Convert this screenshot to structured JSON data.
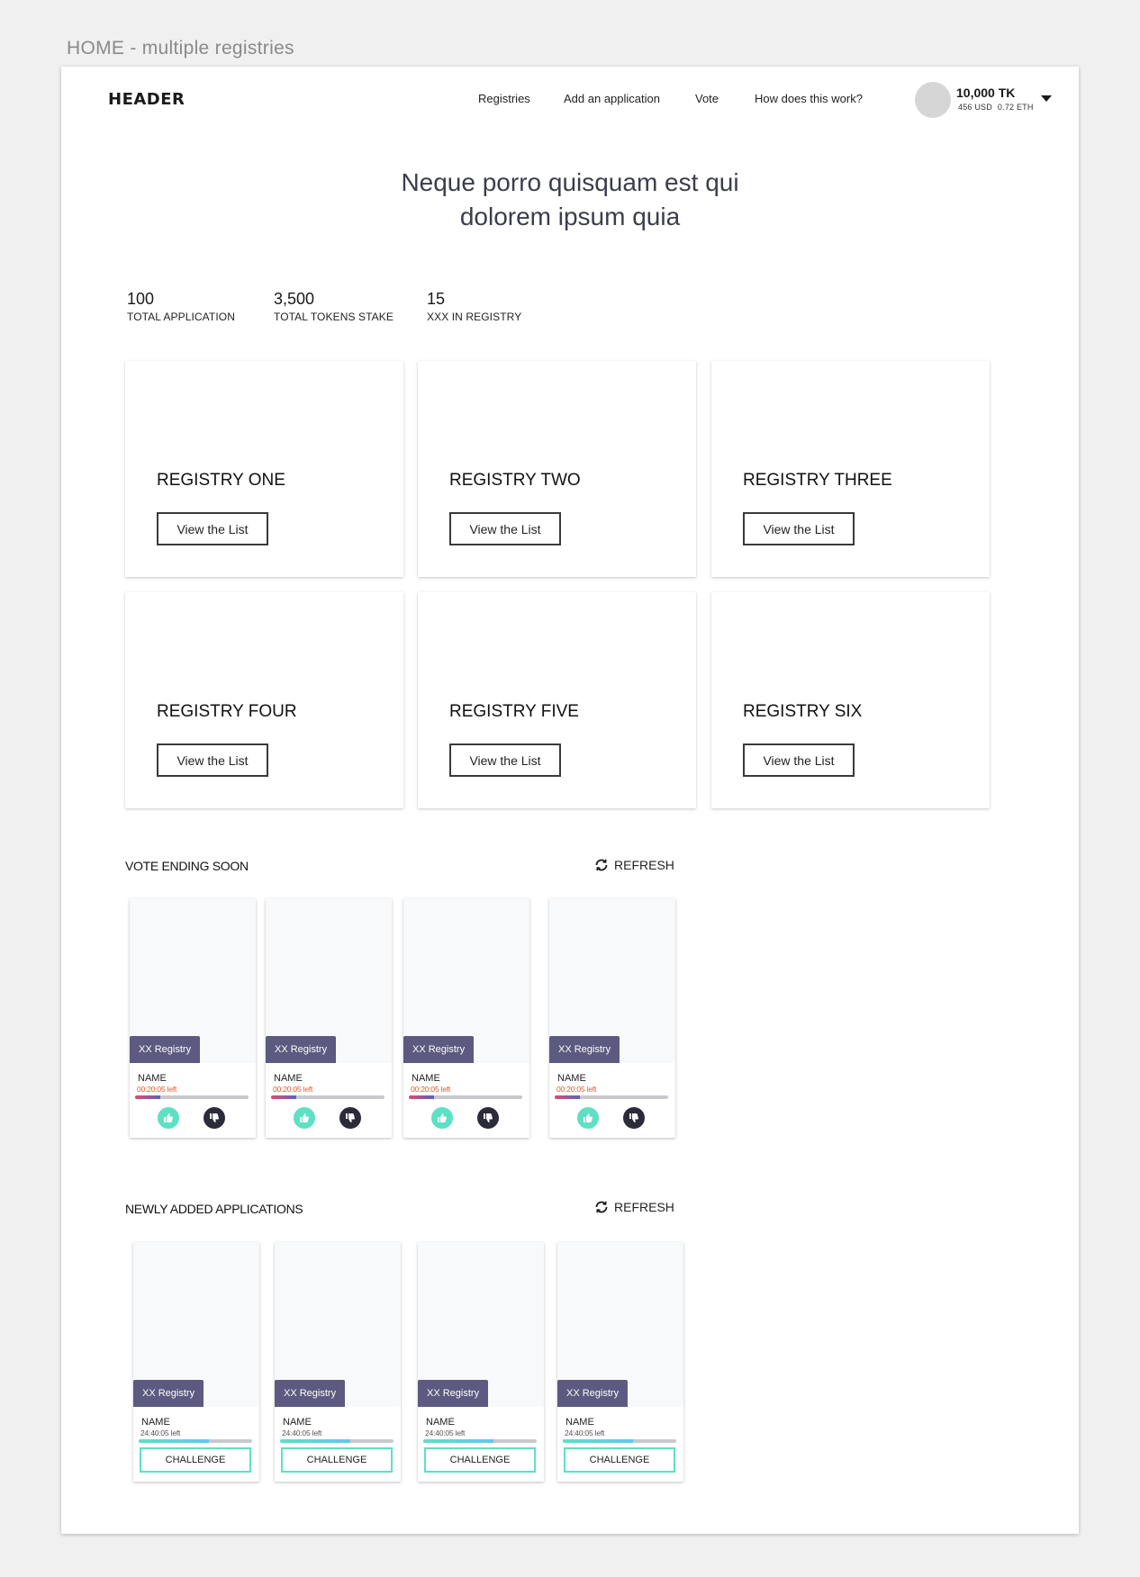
{
  "frame_label": "HOME - multiple registries",
  "header": {
    "logo": "HEADER",
    "nav": [
      {
        "label": "Registries"
      },
      {
        "label": "Add an application"
      },
      {
        "label": "Vote"
      },
      {
        "label": "How does this work?"
      }
    ],
    "wallet": {
      "tokens": "10,000 TK",
      "usd": "456 USD",
      "eth": "0.72 ETH"
    }
  },
  "hero": {
    "line1": "Neque porro quisquam est qui",
    "line2": "dolorem ipsum quia"
  },
  "stats": [
    {
      "value": "100",
      "label": "TOTAL APPLICATION"
    },
    {
      "value": "3,500",
      "label": "TOTAL TOKENS STAKE"
    },
    {
      "value": "15",
      "label": "XXX IN REGISTRY"
    }
  ],
  "registries": [
    {
      "name": "REGISTRY ONE",
      "button": "View the List"
    },
    {
      "name": "REGISTRY TWO",
      "button": "View the List"
    },
    {
      "name": "REGISTRY THREE",
      "button": "View the List"
    },
    {
      "name": "REGISTRY FOUR",
      "button": "View the List"
    },
    {
      "name": "REGISTRY FIVE",
      "button": "View the List"
    },
    {
      "name": "REGISTRY SIX",
      "button": "View the List"
    }
  ],
  "vote_ending": {
    "title": "VOTE ENDING SOON",
    "refresh": "REFRESH",
    "cards": [
      {
        "tag": "XX Registry",
        "name": "NAME",
        "time": "00:20:05 left",
        "progress": 0.22
      },
      {
        "tag": "XX Registry",
        "name": "NAME",
        "time": "00:20:05 left",
        "progress": 0.22
      },
      {
        "tag": "XX Registry",
        "name": "NAME",
        "time": "00:20:05 left",
        "progress": 0.22
      },
      {
        "tag": "XX Registry",
        "name": "NAME",
        "time": "00:20:05 left",
        "progress": 0.22
      }
    ]
  },
  "newly_added": {
    "title": "NEWLY ADDED APPLICATIONS",
    "refresh": "REFRESH",
    "cards": [
      {
        "tag": "XX Registry",
        "name": "NAME",
        "time": "24:40:05 left",
        "progress": 0.62,
        "button": "CHALLENGE"
      },
      {
        "tag": "XX Registry",
        "name": "NAME",
        "time": "24:40:05 left",
        "progress": 0.62,
        "button": "CHALLENGE"
      },
      {
        "tag": "XX Registry",
        "name": "NAME",
        "time": "24:40:05 left",
        "progress": 0.62,
        "button": "CHALLENGE"
      },
      {
        "tag": "XX Registry",
        "name": "NAME",
        "time": "24:40:05 left",
        "progress": 0.62,
        "button": "CHALLENGE"
      }
    ]
  },
  "colors": {
    "tag_bg": "#5c5a80",
    "vote_time": "#e8542a",
    "vote_fill": "#5f5fc6",
    "vote_fill_accent": "#e14b6b",
    "new_time": "#555555",
    "new_fill": "#5ee0c4",
    "new_fill_accent": "#63c6f0",
    "vote_up": "#5ee0c4",
    "vote_down": "#2c2b3a"
  },
  "icons": {
    "refresh": "refresh-icon",
    "thumbs_up": "thumbs-up-icon",
    "thumbs_down": "thumbs-down-icon",
    "dropdown": "chevron-down-icon"
  }
}
